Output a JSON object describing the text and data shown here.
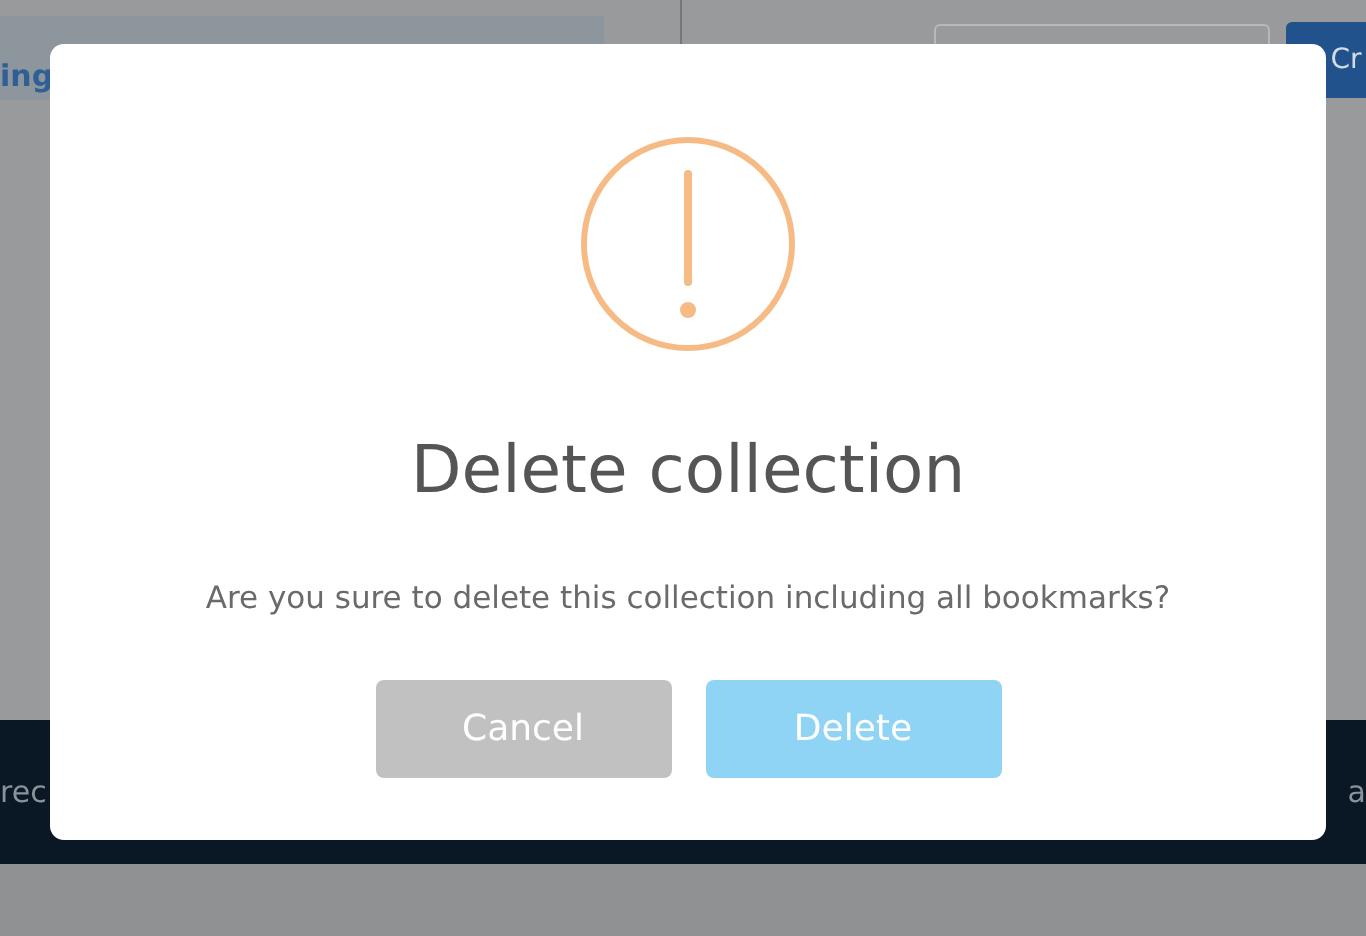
{
  "background": {
    "tab_text": "ing",
    "button_text": "Cr",
    "footer_texts": [
      "rec",
      "a"
    ]
  },
  "dialog": {
    "title": "Delete collection",
    "message": "Are you sure to delete this collection including all bookmarks?",
    "buttons": [
      {
        "label": "Cancel",
        "kind": "cancel"
      },
      {
        "label": "Delete",
        "kind": "confirm"
      }
    ]
  }
}
